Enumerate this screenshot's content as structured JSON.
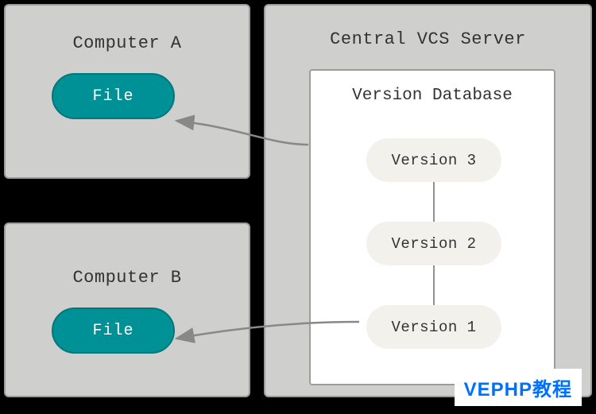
{
  "computer_a": {
    "title": "Computer A",
    "file_label": "File"
  },
  "computer_b": {
    "title": "Computer B",
    "file_label": "File"
  },
  "server": {
    "title": "Central VCS Server",
    "database": {
      "title": "Version Database",
      "versions": {
        "v3": "Version 3",
        "v2": "Version 2",
        "v1": "Version 1"
      }
    }
  },
  "watermark": "VEPHP教程",
  "colors": {
    "panel_bg": "#cfcfcd",
    "panel_border": "#9c9c9c",
    "file_pill": "#009196",
    "version_pill": "#f3f1ec",
    "arrow": "#888888",
    "watermark_text": "#0070ff"
  }
}
